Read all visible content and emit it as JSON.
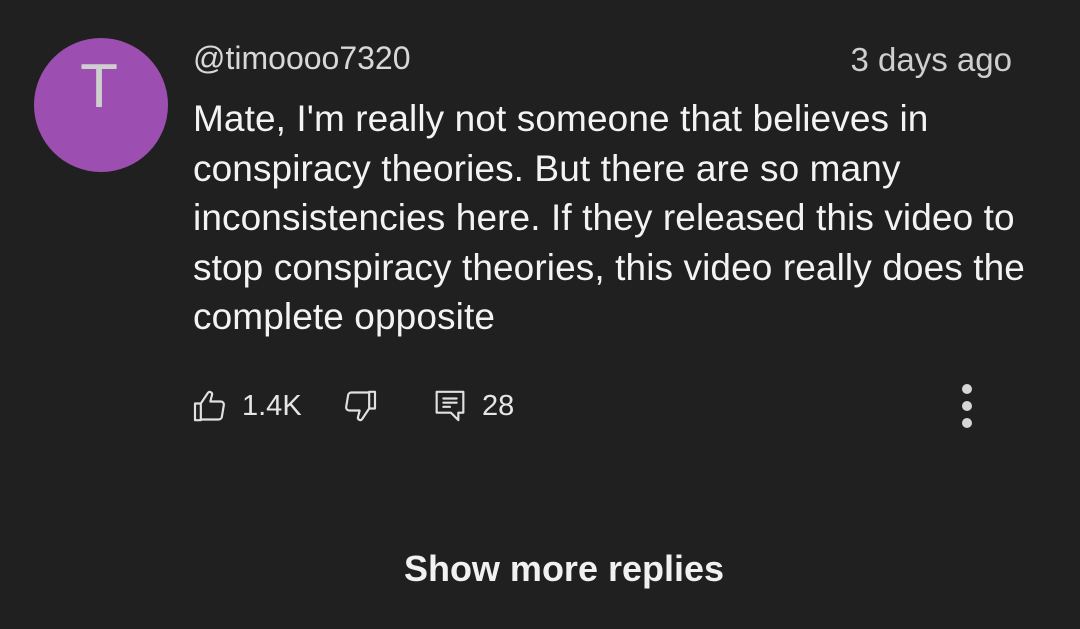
{
  "comment": {
    "avatar_letter": "T",
    "avatar_color": "#9c4fb0",
    "author": "@timoooo7320",
    "timestamp": "3 days ago",
    "text": "Mate, I'm really not someone that believes in conspiracy theories. But there are so many inconsistencies here. If they released this video to stop conspiracy theories, this video really does the complete opposite",
    "actions": {
      "like_icon": "thumbs-up-icon",
      "like_count": "1.4K",
      "dislike_icon": "thumbs-down-icon",
      "reply_icon": "comment-icon",
      "reply_count": "28",
      "more_icon": "more-vertical-icon"
    }
  },
  "footer": {
    "show_more_label": "Show more replies"
  },
  "colors": {
    "background": "#202020",
    "text": "#f1f1f1"
  }
}
